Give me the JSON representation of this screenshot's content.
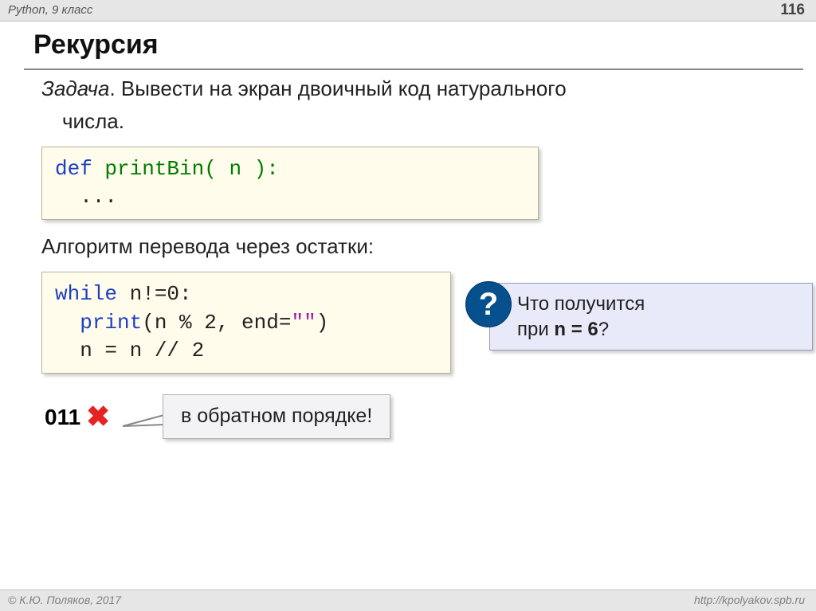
{
  "header": {
    "left": "Python, 9 класс",
    "page": "116"
  },
  "title": "Рекурсия",
  "task": {
    "label": "Задача",
    "text1": ". Вывести на экран двоичный код натурального",
    "text2": "числа."
  },
  "code1": {
    "kw_def": "def",
    "fn": " printBin( n ):",
    "body": "  ..."
  },
  "algo": "Алгоритм перевода через остатки:",
  "code2": {
    "kw_while": "while",
    "cond": " n!=0:",
    "indent1": "  ",
    "kw_print": "print",
    "args_a": "(n % 2, end=",
    "str_empty": "\"\"",
    "args_b": ")",
    "line3": "  n = n // 2"
  },
  "question": {
    "mark": "?",
    "line1": "Что получится",
    "line2a": "при ",
    "line2b": "n = 6",
    "line2c": "?"
  },
  "result": {
    "output": "011",
    "callout": "в обратном порядке!"
  },
  "footer": {
    "left": "© К.Ю. Поляков, 2017",
    "right": "http://kpolyakov.spb.ru"
  }
}
